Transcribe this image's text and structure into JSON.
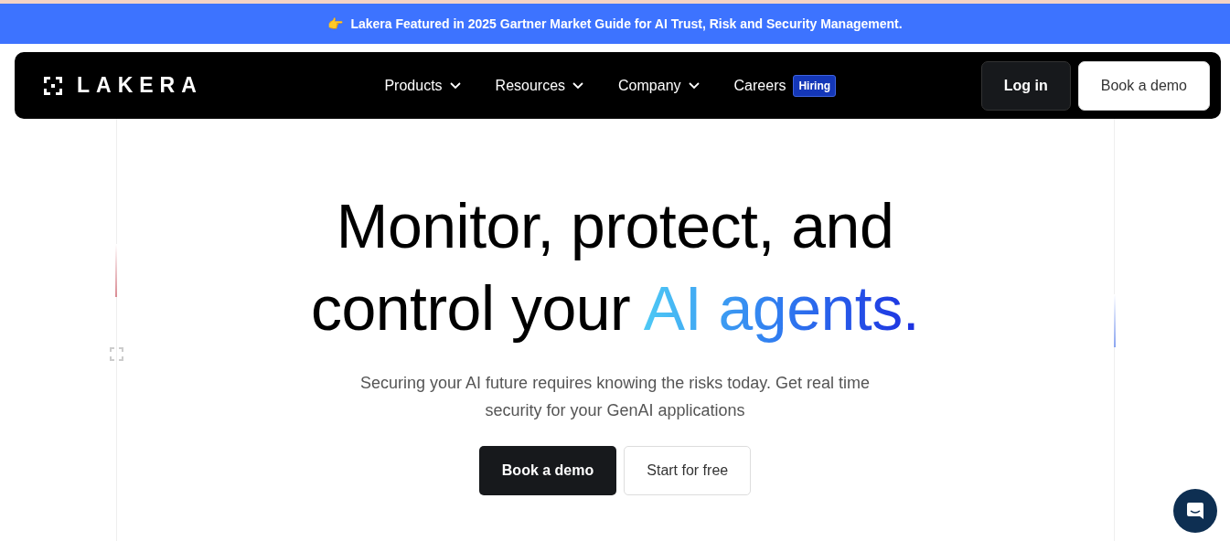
{
  "banner": {
    "emoji": "👉",
    "text": "Lakera Featured in 2025 Gartner Market Guide for AI Trust, Risk and Security Management."
  },
  "navbar": {
    "logo": "LAKERA",
    "items": [
      {
        "kind": "dropdown",
        "label": "Products"
      },
      {
        "kind": "dropdown",
        "label": "Resources"
      },
      {
        "kind": "dropdown",
        "label": "Company"
      },
      {
        "kind": "link",
        "label": "Careers",
        "badge": "Hiring"
      }
    ],
    "buttons": [
      {
        "kind": "dark",
        "label": "Log in"
      },
      {
        "kind": "light",
        "label": "Book a demo"
      }
    ]
  },
  "hero": {
    "headline": "Monitor, protect, and control your ",
    "headline_highlight": "AI agents.",
    "subtitle": "Securing your AI future requires knowing the risks today. Get real time security for your GenAI applications",
    "buttons": [
      {
        "kind": "dark",
        "label": "Book a demo"
      },
      {
        "kind": "light",
        "label": "Start for free"
      }
    ]
  }
}
